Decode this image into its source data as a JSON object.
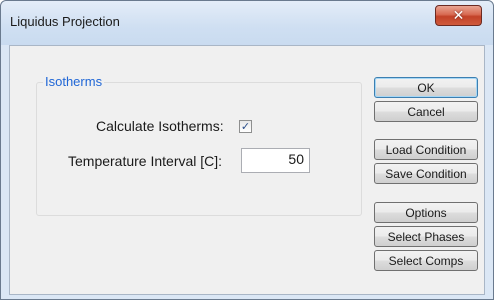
{
  "window": {
    "title": "Liquidus Projection",
    "close_glyph": "✕"
  },
  "group": {
    "legend": "Isotherms"
  },
  "form": {
    "calculate_label": "Calculate Isotherms:",
    "calculate_checked": true,
    "check_glyph": "✓",
    "interval_label": "Temperature Interval [C]:",
    "interval_value": "50"
  },
  "buttons": {
    "ok": "OK",
    "cancel": "Cancel",
    "load": "Load Condition",
    "save": "Save Condition",
    "options": "Options",
    "select_phases": "Select Phases",
    "select_comps": "Select Comps"
  },
  "colors": {
    "group_legend": "#1f66d6",
    "close_button": "#c24128"
  }
}
